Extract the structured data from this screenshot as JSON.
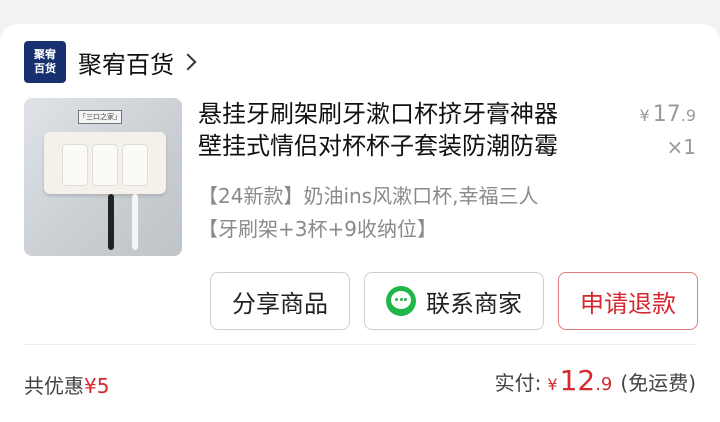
{
  "shop": {
    "logo_line1": "聚宥",
    "logo_line2": "百货",
    "name": "聚宥百货"
  },
  "product": {
    "title_line1": "悬挂牙刷架刷牙漱口杯挤牙膏神器",
    "title_line2": "壁挂式情侣对杯杯子套装防潮防霉",
    "spec_line1": "【24新款】奶油ins风漱口杯,幸福三人",
    "spec_line2": "【牙刷架+3杯+9收纳位】",
    "image_sign_text": "「三口之家」",
    "price_currency": "¥",
    "price_int": "17",
    "price_dec": ".9",
    "quantity": "×1"
  },
  "buttons": {
    "share": "分享商品",
    "contact": "联系商家",
    "refund": "申请退款"
  },
  "footer": {
    "promo_label": "共优惠",
    "promo_amount": "¥5",
    "paid_label": "实付:",
    "paid_currency": "¥",
    "paid_int": "12",
    "paid_dec": ".9",
    "shipping": "(免运费)"
  },
  "colors": {
    "accent_red": "#d6282e",
    "wechat_green": "#20b64a",
    "logo_blue": "#17306f"
  }
}
